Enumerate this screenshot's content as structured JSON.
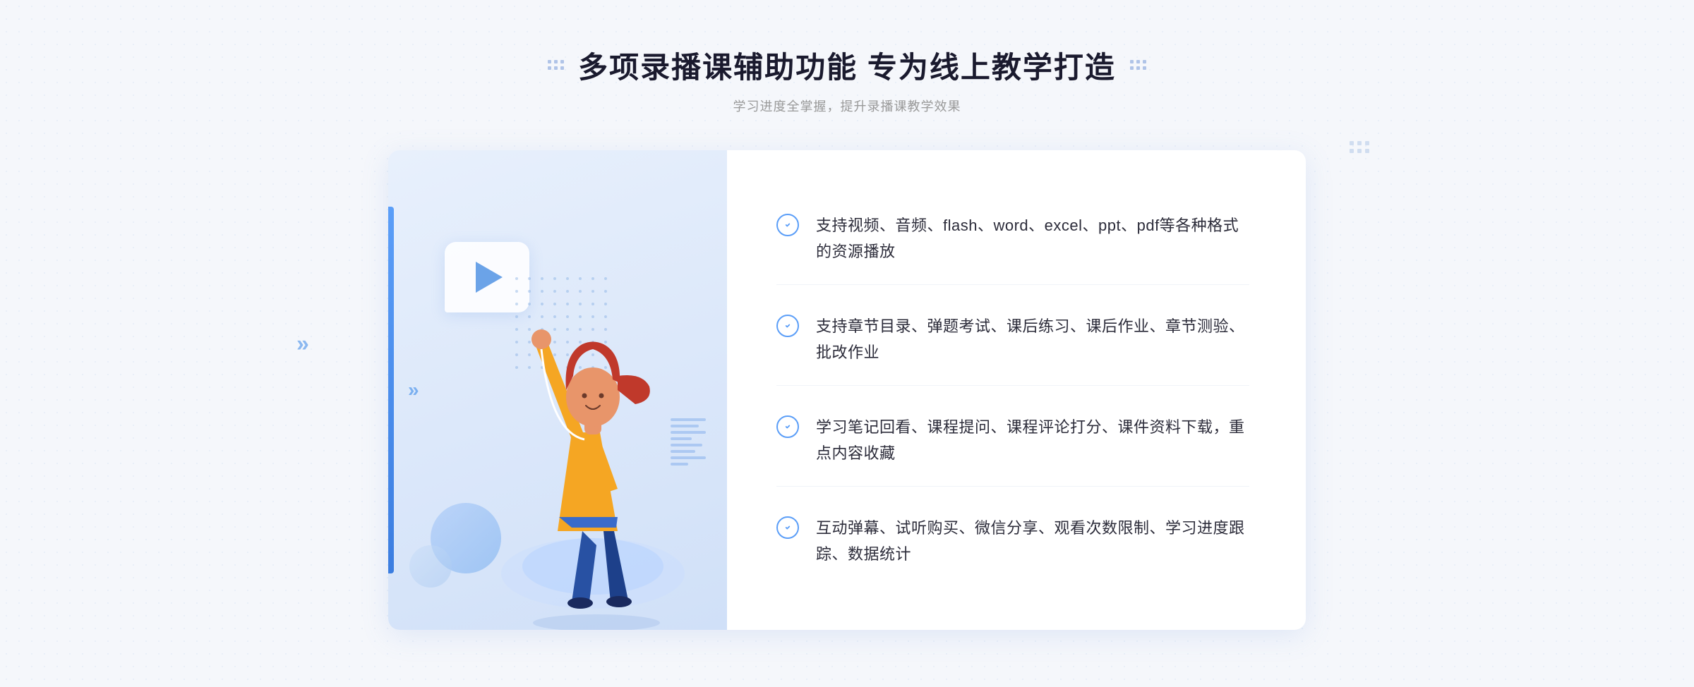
{
  "page": {
    "background_color": "#f5f7fb"
  },
  "header": {
    "title": "多项录播课辅助功能 专为线上教学打造",
    "subtitle": "学习进度全掌握，提升录播课教学效果"
  },
  "features": [
    {
      "id": 1,
      "text": "支持视频、音频、flash、word、excel、ppt、pdf等各种格式的资源播放"
    },
    {
      "id": 2,
      "text": "支持章节目录、弹题考试、课后练习、课后作业、章节测验、批改作业"
    },
    {
      "id": 3,
      "text": "学习笔记回看、课程提问、课程评论打分、课件资料下载，重点内容收藏"
    },
    {
      "id": 4,
      "text": "互动弹幕、试听购买、微信分享、观看次数限制、学习进度跟踪、数据统计"
    }
  ],
  "icons": {
    "check": "check-circle-icon",
    "play": "play-icon",
    "arrow_left": "»"
  },
  "decorations": {
    "title_dots_left": ":::::",
    "title_dots_right": ":::::"
  }
}
